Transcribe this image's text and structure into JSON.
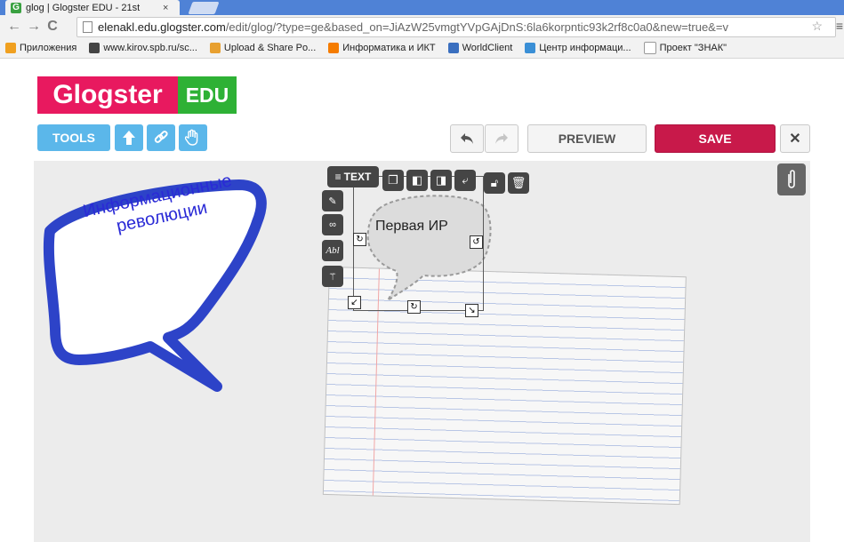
{
  "browser": {
    "tab_title": "glog | Glogster EDU - 21st",
    "tab_favicon": "G",
    "tab_close": "×",
    "url_domain": "elenakl.edu.glogster.com",
    "url_path": "/edit/glog/?type=ge&based_on=JiAzW25vmgtYVpGAjDnS:6la6korpntic93k2rf8c0a0&new=true&=v",
    "back_icon": "←",
    "forward_icon": "→",
    "reload_icon": "C",
    "star_icon": "☆",
    "menu_icon": "≡"
  },
  "bookmarks": [
    {
      "label": "Приложения",
      "color": "#f0a020",
      "icon": "apps-icon"
    },
    {
      "label": "www.kirov.spb.ru/sc...",
      "color": "#444444",
      "icon": "site-icon"
    },
    {
      "label": "Upload & Share Po...",
      "color": "#e8a030",
      "icon": "upload-icon"
    },
    {
      "label": "Информатика и ИКТ",
      "color": "#f57c00",
      "icon": "blogger-icon"
    },
    {
      "label": "WorldClient",
      "color": "#3a6fbf",
      "icon": "globe-icon"
    },
    {
      "label": "Центр информаци...",
      "color": "#3a8fd6",
      "icon": "folder-icon"
    },
    {
      "label": "Проект \"ЗНАК\"",
      "color": "#ffffff",
      "icon": "page-icon"
    }
  ],
  "app": {
    "logo_main": "Glogster",
    "logo_edu": "EDU",
    "tools_label": "TOOLS",
    "preview_label": "PREVIEW",
    "save_label": "SAVE",
    "close_label": "✕",
    "save_color": "#c8194a"
  },
  "canvas": {
    "speech_bubble_text": "Информационные революции",
    "small_bubble_text": "Первая ИР",
    "text_tool_label": "TEXT"
  }
}
